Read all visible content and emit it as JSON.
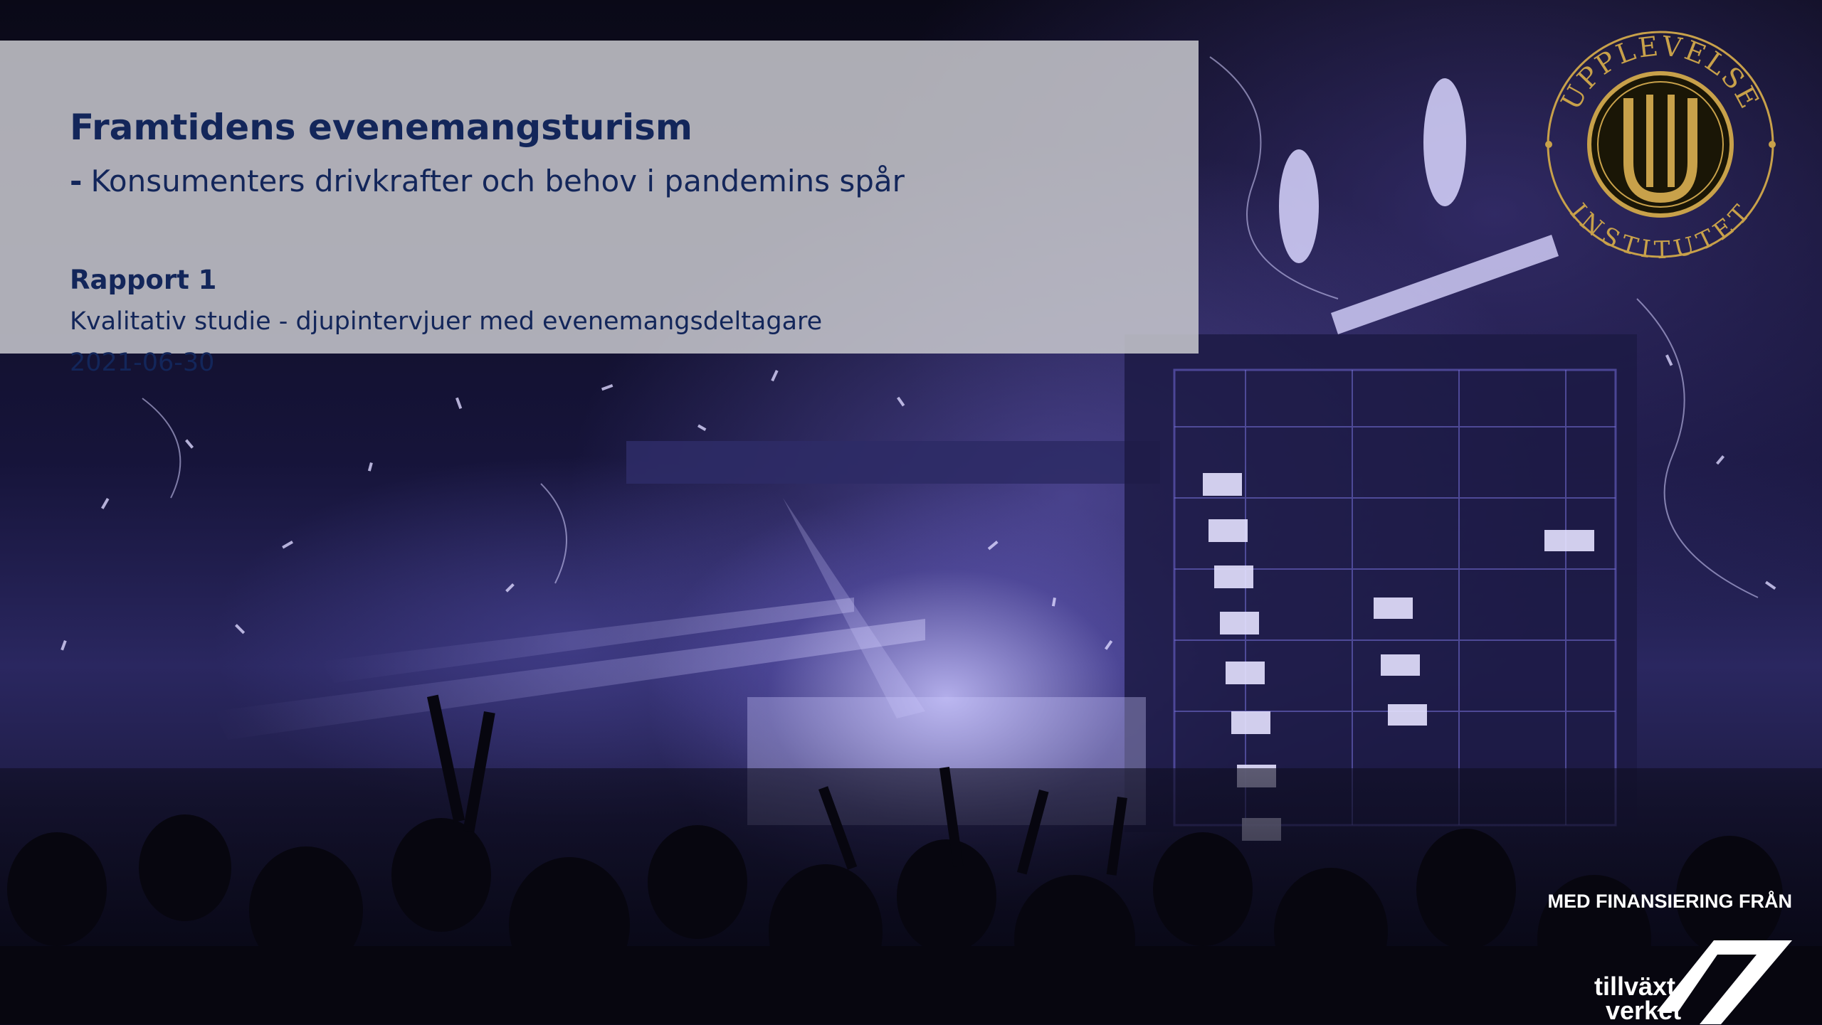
{
  "cover": {
    "title": "Framtidens evenemangsturism",
    "subtitle_dash": "-",
    "subtitle": "Konsumenters drivkrafter och behov i pandemins spår",
    "report_number": "Rapport 1",
    "description": "Kvalitativ studie - djupintervjuer med evenemangsdeltagare",
    "date": "2021-06-30"
  },
  "seal_logo": {
    "top_text": "UPPLEVELSE",
    "bottom_text": "INSTITUTET",
    "monogram": "U",
    "color": "#c8a14a"
  },
  "funding": {
    "caption": "MED FINANSIERING FRÅN",
    "logo_line1": "tillväxt",
    "logo_line2": "verket"
  },
  "colors": {
    "title_text": "#13265a",
    "panel": "#c8c8ce",
    "photo_tint": "#6f68d6"
  }
}
